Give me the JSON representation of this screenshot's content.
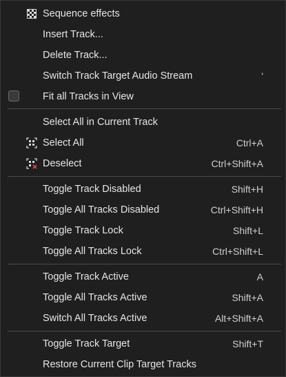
{
  "menu": {
    "items": [
      {
        "label": "Sequence effects",
        "shortcut": "",
        "icon": "sequence-effects-icon"
      },
      {
        "label": "Insert Track...",
        "shortcut": ""
      },
      {
        "label": "Delete Track...",
        "shortcut": ""
      },
      {
        "label": "Switch Track Target Audio Stream",
        "shortcut": "'"
      },
      {
        "label": "Fit all Tracks in View",
        "shortcut": "",
        "checkbox": false
      },
      {
        "label": "Select All in Current Track",
        "shortcut": ""
      },
      {
        "label": "Select All",
        "shortcut": "Ctrl+A",
        "icon": "select-all-icon"
      },
      {
        "label": "Deselect",
        "shortcut": "Ctrl+Shift+A",
        "icon": "deselect-icon"
      },
      {
        "label": "Toggle Track Disabled",
        "shortcut": "Shift+H"
      },
      {
        "label": "Toggle All Tracks Disabled",
        "shortcut": "Ctrl+Shift+H"
      },
      {
        "label": "Toggle Track Lock",
        "shortcut": "Shift+L"
      },
      {
        "label": "Toggle All Tracks Lock",
        "shortcut": "Ctrl+Shift+L"
      },
      {
        "label": "Toggle Track Active",
        "shortcut": "A"
      },
      {
        "label": "Toggle All Tracks Active",
        "shortcut": "Shift+A"
      },
      {
        "label": "Switch All Tracks Active",
        "shortcut": "Alt+Shift+A"
      },
      {
        "label": "Toggle Track Target",
        "shortcut": "Shift+T"
      },
      {
        "label": "Restore Current Clip Target Tracks",
        "shortcut": ""
      }
    ]
  },
  "colors": {
    "background": "#1f1f1f",
    "text": "#e6e6e6",
    "separator": "#4a4a4a",
    "deselect_mark": "#e04a4a"
  }
}
